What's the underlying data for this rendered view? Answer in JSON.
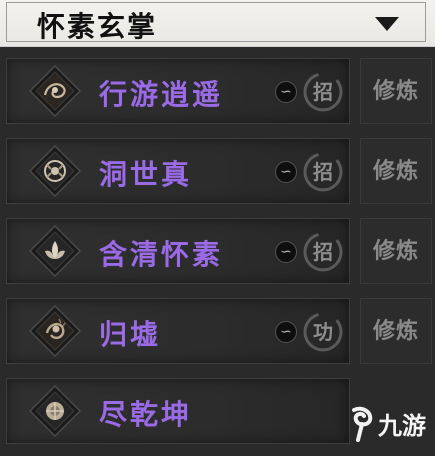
{
  "header": {
    "title": "怀素玄掌",
    "dropdown_icon": "triangle-down-icon"
  },
  "skills": [
    {
      "name": "行游逍遥",
      "type_label": "招",
      "train_label": "修炼",
      "icon": "ink-swirl-icon"
    },
    {
      "name": "洞世真",
      "type_label": "招",
      "train_label": "修炼",
      "icon": "ink-lotus-icon"
    },
    {
      "name": "含清怀素",
      "type_label": "招",
      "train_label": "修炼",
      "icon": "ink-lotus-icon"
    },
    {
      "name": "归墟",
      "type_label": "功",
      "train_label": "修炼",
      "icon": "ink-swirl-icon"
    },
    {
      "name": "尽乾坤",
      "type_label": "",
      "train_label": "",
      "icon": "ink-lotus-icon"
    }
  ],
  "watermark": {
    "text": "九游"
  },
  "colors": {
    "skill_name": "#9b6ae6",
    "background": "#2a2a2a",
    "header_bg": "#f0efeb"
  }
}
